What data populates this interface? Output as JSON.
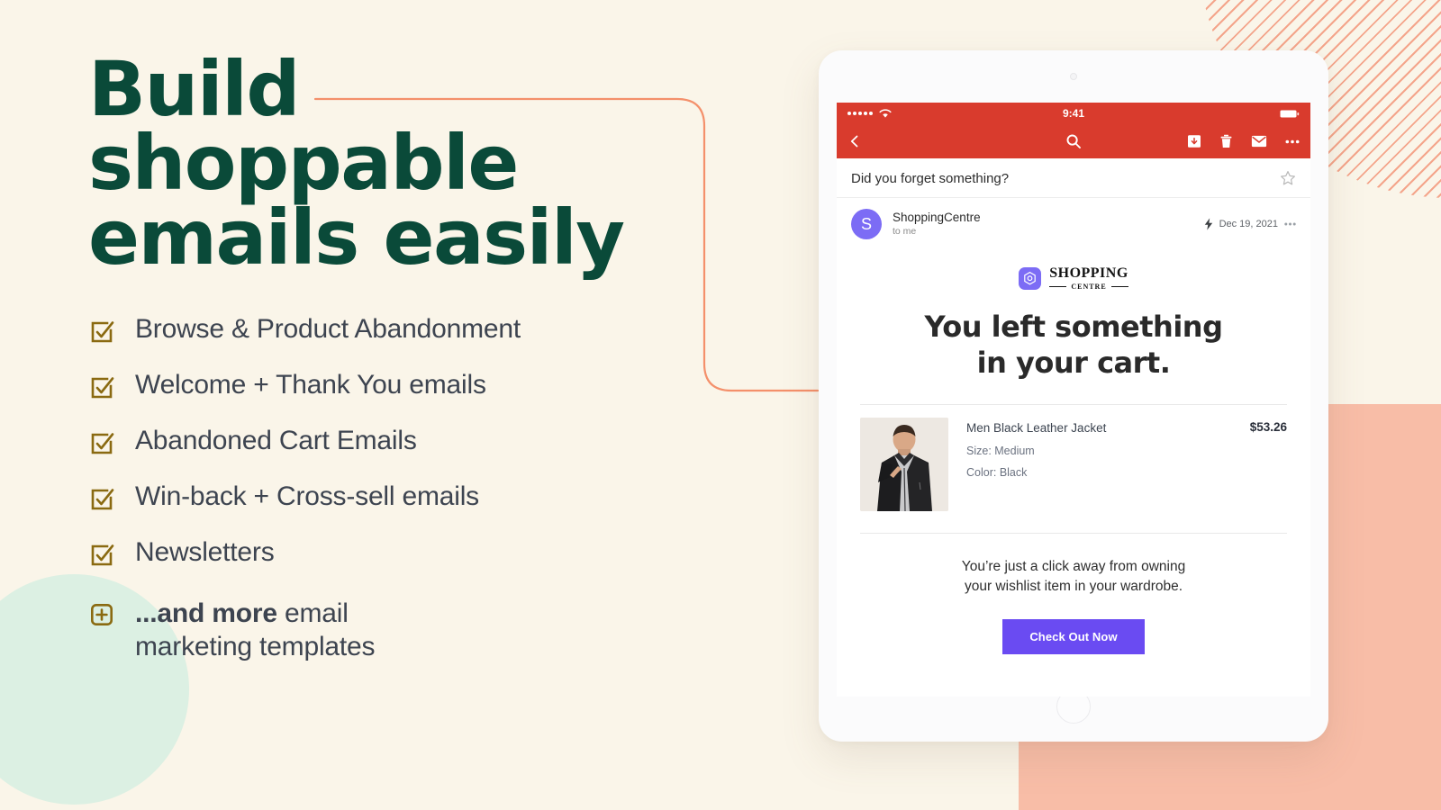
{
  "palette": {
    "background": "#FAF5E9",
    "headline_green": "#0A4A39",
    "checkbox_olive": "#8A6A11",
    "connector_orange": "#F4906B",
    "coral_block": "#F8BDA7",
    "mint_circle": "#DCF0E3",
    "mail_red": "#D93B2D",
    "brand_purple": "#7C6CF5",
    "cta_purple": "#6A4BF2",
    "body_text": "#3D4450"
  },
  "promo": {
    "headline_lines": [
      "Build",
      "shoppable",
      "emails easily"
    ],
    "features": [
      {
        "icon": "checkbox-checked-icon",
        "label": "Browse & Product Abandonment"
      },
      {
        "icon": "checkbox-checked-icon",
        "label": "Welcome + Thank You emails"
      },
      {
        "icon": "checkbox-checked-icon",
        "label": "Abandoned Cart Emails"
      },
      {
        "icon": "checkbox-checked-icon",
        "label": "Win-back + Cross-sell emails"
      },
      {
        "icon": "checkbox-checked-icon",
        "label": "Newsletters"
      }
    ],
    "more_item": {
      "icon": "plus-box-icon",
      "strong": "...and more",
      "rest": " email",
      "line2": "marketing templates"
    }
  },
  "device": {
    "type": "tablet",
    "camera": "camera-dot",
    "home_button": "home-button"
  },
  "mail_app": {
    "status_bar": {
      "signal": "signal-dots-icon",
      "wifi": "wifi-icon",
      "time": "9:41",
      "battery": "battery-full-icon"
    },
    "app_bar": {
      "back": "back-arrow-icon",
      "search": "search-icon",
      "actions": [
        "archive-icon",
        "trash-icon",
        "mail-icon",
        "overflow-menu-icon"
      ]
    },
    "subject": "Did you forget something?",
    "star": "star-outline-icon",
    "sender": {
      "avatar_initial": "S",
      "name": "ShoppingCentre",
      "recipient": "to me",
      "important_marker": "lightning-bolt-icon",
      "date": "Dec 19, 2021",
      "overflow": "overflow-menu-icon"
    }
  },
  "email": {
    "brand": {
      "logo": "hexagon-logo-icon",
      "name": "SHOPPING",
      "sub": "CENTRE"
    },
    "headline_lines": [
      "You left something",
      "in your cart."
    ],
    "product": {
      "image": "leather-jacket-photo",
      "title": "Men Black Leather Jacket",
      "size": "Size: Medium",
      "color": "Color: Black",
      "price": "$53.26"
    },
    "cta": {
      "copy_lines": [
        "You’re just a click away from owning",
        "your wishlist item in your wardrobe."
      ],
      "button_label": "Check Out Now"
    }
  }
}
